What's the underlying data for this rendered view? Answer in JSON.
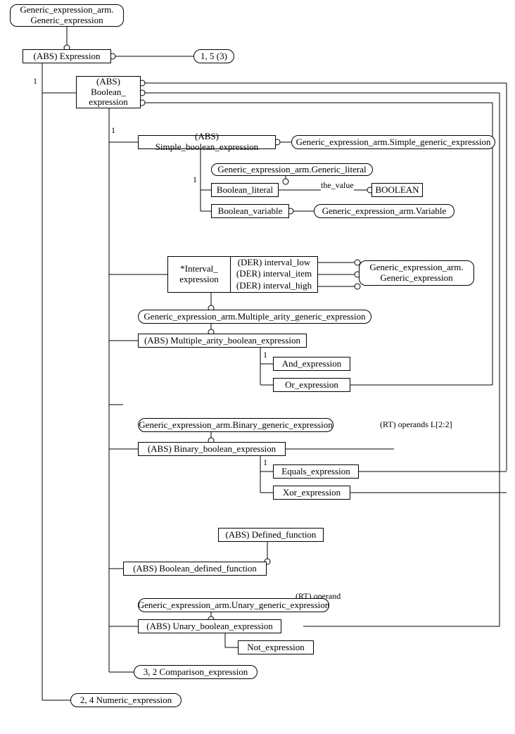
{
  "root_arm": "Generic_expression_arm.\nGeneric_expression",
  "expression": "(ABS) Expression",
  "expr_page_ref": "1, 5 (3)",
  "boolean_expression": "(ABS)\nBoolean_\nexpression",
  "simple": {
    "header": "(ABS) Simple_boolean_expression",
    "super": "Generic_expression_arm.Simple_generic_expression",
    "literal_super": "Generic_expression_arm.Generic_literal",
    "literal": "Boolean_literal",
    "literal_attr": "the_value",
    "literal_type": "BOOLEAN",
    "variable": "Boolean_variable",
    "variable_super": "Generic_expression_arm.Variable"
  },
  "interval": {
    "name": "*Interval_\nexpression",
    "attr_low": "(DER) interval_low",
    "attr_item": "(DER) interval_item",
    "attr_high": "(DER) interval_high",
    "ref": "Generic_expression_arm.\nGeneric_expression"
  },
  "multi": {
    "super": "Generic_expression_arm.Multiple_arity_generic_expression",
    "header": "(ABS) Multiple_arity_boolean_expression",
    "and": "And_expression",
    "or": "Or_expression"
  },
  "binary": {
    "super": "Generic_expression_arm.Binary_generic_expression",
    "header": "(ABS) Binary_boolean_expression",
    "eq": "Equals_expression",
    "xor": "Xor_expression",
    "operands": "(RT) operands L[2:2]"
  },
  "defined": {
    "sup": "(ABS) Defined_function",
    "header": "(ABS) Boolean_defined_function"
  },
  "unary": {
    "super": "Generic_expression_arm.Unary_generic_expression",
    "header": "(ABS) Unary_boolean_expression",
    "not": "Not_expression",
    "operand": "(RT) operand"
  },
  "comparison_ref": "3, 2 Comparison_expression",
  "numeric_ref": "2, 4 Numeric_expression",
  "one": "1"
}
